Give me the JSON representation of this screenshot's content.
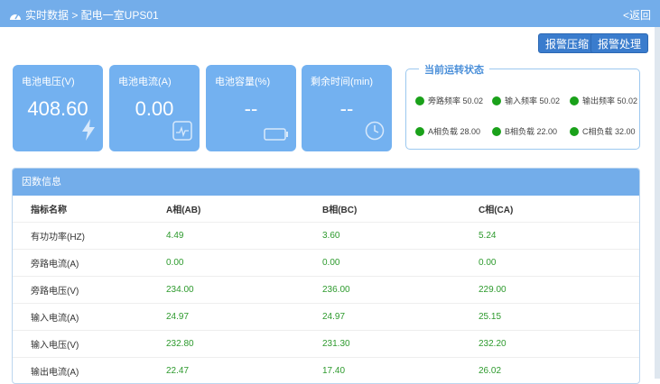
{
  "header": {
    "breadcrumb": "实时数据 > 配电一室UPS01",
    "back_label": "<返回"
  },
  "actions": {
    "alarm_compress": "报警压缩",
    "alarm_handle": "报警处理"
  },
  "cards": [
    {
      "title": "电池电压(V)",
      "value": "408.60",
      "icon": "lightning-icon"
    },
    {
      "title": "电池电流(A)",
      "value": "0.00",
      "icon": "meter-icon"
    },
    {
      "title": "电池容量(%)",
      "value": "--",
      "icon": "battery-icon"
    },
    {
      "title": "剩余时间(min)",
      "value": "--",
      "icon": "clock-icon"
    }
  ],
  "status": {
    "legend": "当前运转状态",
    "items": [
      "旁路频率 50.02",
      "输入频率 50.02",
      "输出频率 50.02",
      "A相负载 28.00",
      "B相负载 22.00",
      "C相负载 32.00"
    ],
    "indicator_color": "#1aa11a"
  },
  "params": {
    "title": "因数信息",
    "columns": [
      "指标名称",
      "A相(AB)",
      "B相(BC)",
      "C相(CA)"
    ],
    "rows": [
      [
        "有功功率(HZ)",
        "4.49",
        "3.60",
        "5.24"
      ],
      [
        "旁路电流(A)",
        "0.00",
        "0.00",
        "0.00"
      ],
      [
        "旁路电压(V)",
        "234.00",
        "236.00",
        "229.00"
      ],
      [
        "输入电流(A)",
        "24.97",
        "24.97",
        "25.15"
      ],
      [
        "输入电压(V)",
        "232.80",
        "231.30",
        "232.20"
      ],
      [
        "输出电流(A)",
        "22.47",
        "17.40",
        "26.02"
      ]
    ]
  },
  "colors": {
    "header": "#73adea",
    "card": "#73b1f0",
    "button": "#3a7ccd",
    "value_green": "#2d9a2d"
  }
}
